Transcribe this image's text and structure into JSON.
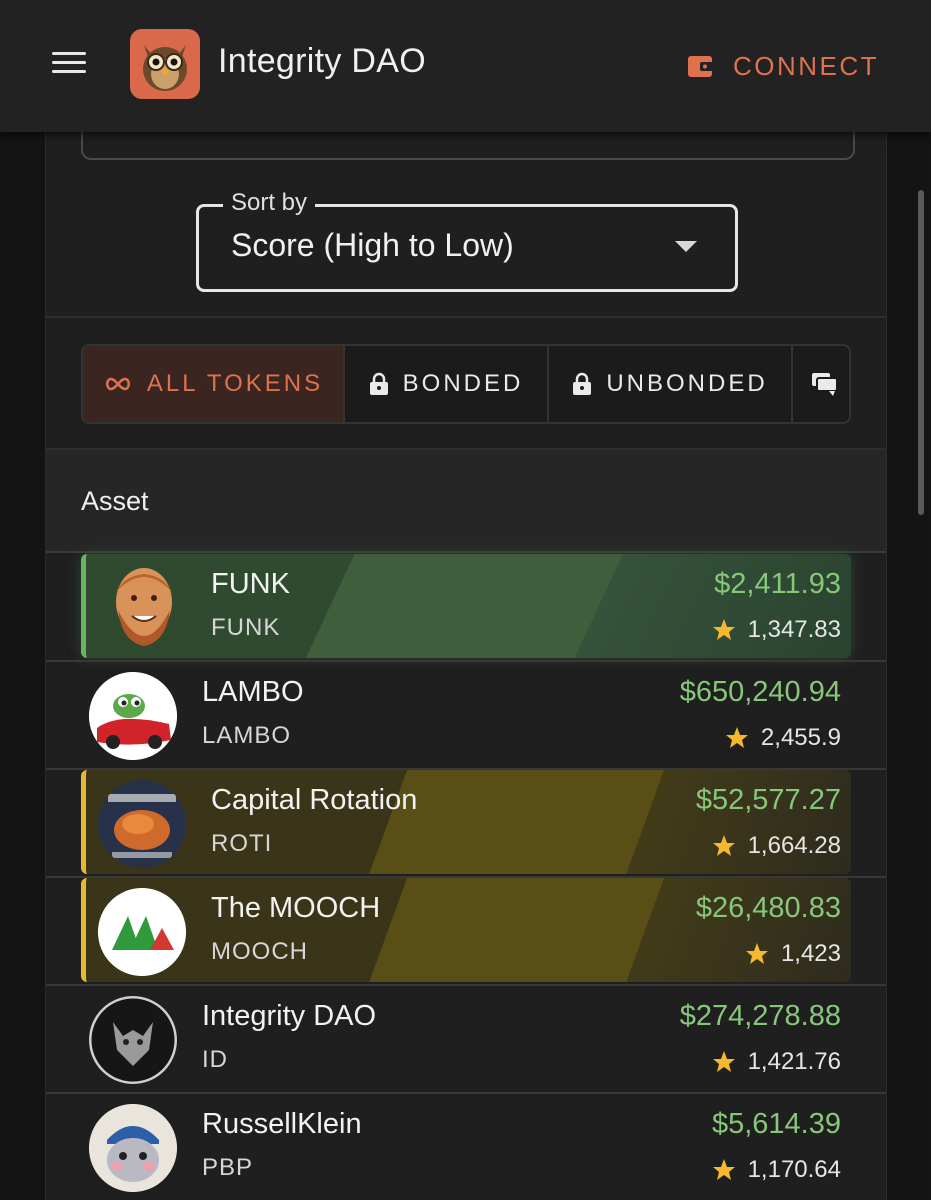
{
  "app": {
    "title": "Integrity DAO",
    "connect_label": "CONNECT"
  },
  "sort": {
    "label": "Sort by",
    "value": "Score (High to Low)"
  },
  "tabs": [
    {
      "label": "ALL TOKENS",
      "icon": "infinity-icon",
      "active": true
    },
    {
      "label": "BONDED",
      "icon": "lock-icon",
      "active": false
    },
    {
      "label": "UNBONDED",
      "icon": "lock-open-icon",
      "active": false
    },
    {
      "label": "",
      "icon": "chat-icon",
      "active": false
    }
  ],
  "table": {
    "header": "Asset",
    "rows": [
      {
        "name": "FUNK",
        "symbol": "FUNK",
        "price": "$2,411.93",
        "score": "1,347.83",
        "highlight": "green"
      },
      {
        "name": "LAMBO",
        "symbol": "LAMBO",
        "price": "$650,240.94",
        "score": "2,455.9",
        "highlight": "none"
      },
      {
        "name": "Capital Rotation",
        "symbol": "ROTI",
        "price": "$52,577.27",
        "score": "1,664.28",
        "highlight": "yellow"
      },
      {
        "name": "The MOOCH",
        "symbol": "MOOCH",
        "price": "$26,480.83",
        "score": "1,423",
        "highlight": "yellow"
      },
      {
        "name": "Integrity DAO",
        "symbol": "ID",
        "price": "$274,278.88",
        "score": "1,421.76",
        "highlight": "none"
      },
      {
        "name": "RussellKlein",
        "symbol": "PBP",
        "price": "$5,614.39",
        "score": "1,170.64",
        "highlight": "none"
      }
    ]
  },
  "colors": {
    "accent": "#e0714f",
    "price_green": "#86c77a",
    "star": "#f5b82e",
    "green_row": "#65b764",
    "yellow_row": "#e6b833"
  }
}
